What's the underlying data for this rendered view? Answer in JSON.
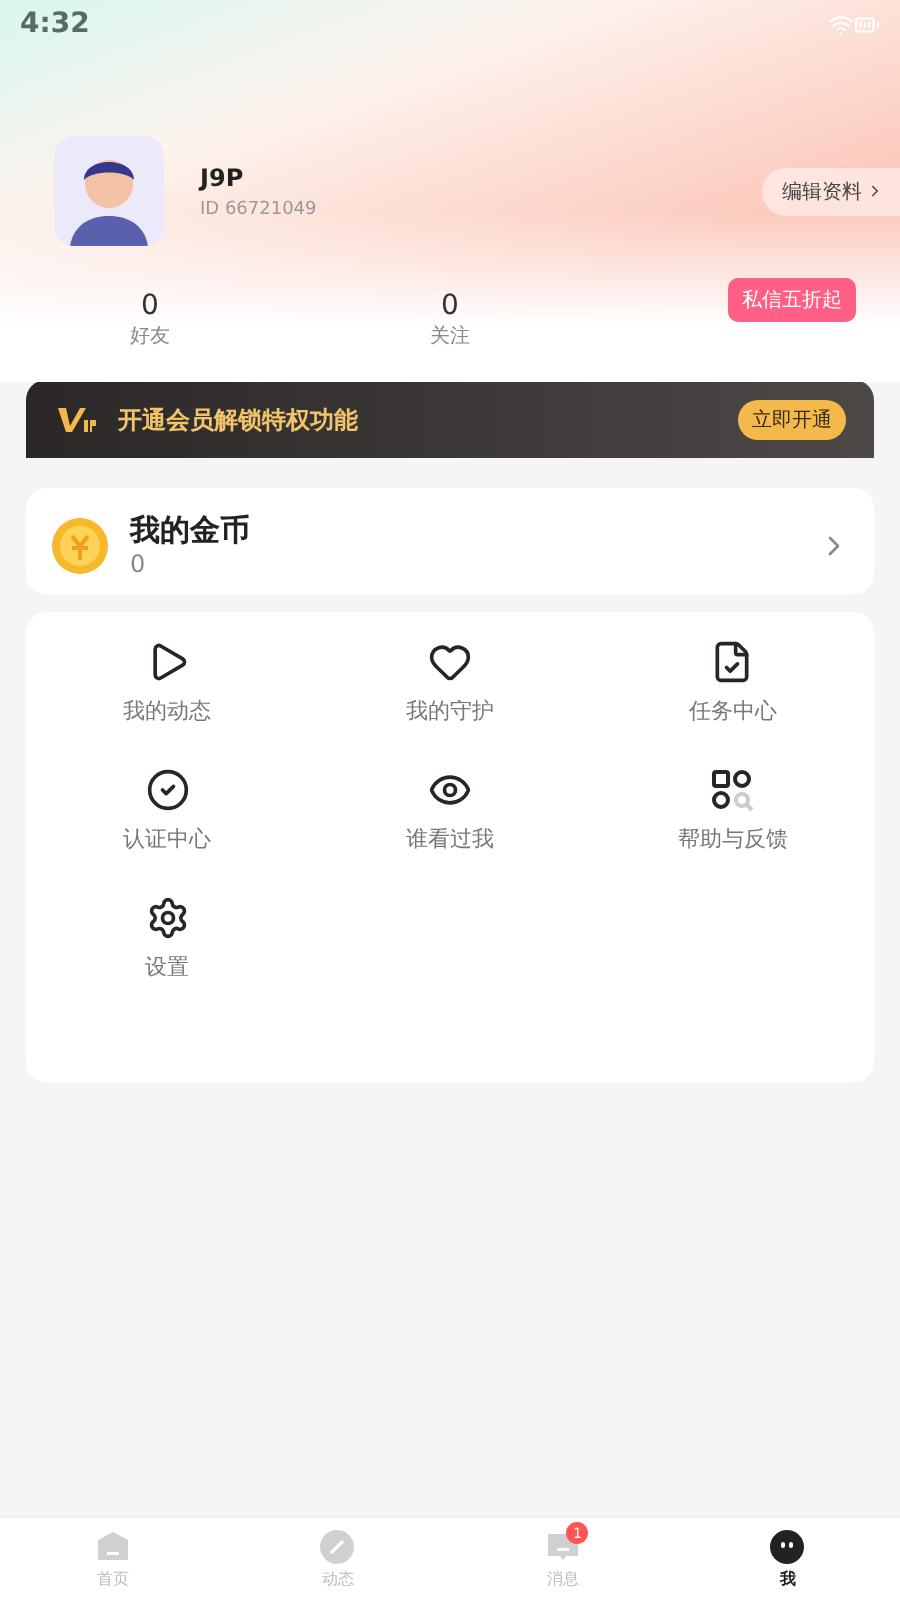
{
  "status_bar": {
    "time": "4:32"
  },
  "profile": {
    "name": "J9P",
    "id": "ID 66721049",
    "edit_button": "编辑资料"
  },
  "stats": [
    {
      "value": "0",
      "label": "好友"
    },
    {
      "value": "0",
      "label": "关注"
    }
  ],
  "tooltip": "私信五折起",
  "vip_banner": {
    "text": "开通会员解锁特权功能",
    "button": "立即开通"
  },
  "coins": {
    "title": "我的金币",
    "value": "0"
  },
  "menu": [
    {
      "kind": "play",
      "label": "我的动态"
    },
    {
      "kind": "heart",
      "label": "我的守护"
    },
    {
      "kind": "task",
      "label": "任务中心"
    },
    {
      "kind": "verify",
      "label": "认证中心"
    },
    {
      "kind": "eye",
      "label": "谁看过我"
    },
    {
      "kind": "help",
      "label": "帮助与反馈"
    },
    {
      "kind": "settings",
      "label": "设置"
    }
  ],
  "tab_bar": [
    {
      "kind": "home",
      "label": "首页",
      "selected": false
    },
    {
      "kind": "feed",
      "label": "动态",
      "selected": false
    },
    {
      "kind": "messages",
      "label": "消息",
      "selected": false,
      "badge": "1"
    },
    {
      "kind": "me",
      "label": "我",
      "selected": true
    }
  ]
}
